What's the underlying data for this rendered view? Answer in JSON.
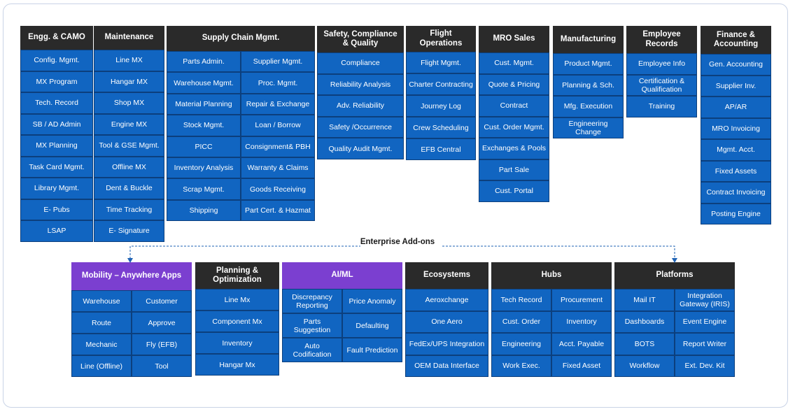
{
  "top_groups": [
    {
      "title": "Engg. & CAMO",
      "items": [
        "Config. Mgmt.",
        "MX Program",
        "Tech. Record",
        "SB / AD Admin",
        "MX Planning",
        "Task Card Mgmt.",
        "Library Mgmt.",
        "E- Pubs",
        "LSAP"
      ]
    },
    {
      "title": "Maintenance",
      "items": [
        "Line MX",
        "Hangar MX",
        "Shop MX",
        "Engine MX",
        "Tool & GSE Mgmt.",
        "Offline MX",
        "Dent & Buckle",
        "Time Tracking",
        "E- Signature"
      ]
    },
    {
      "title": "Supply Chain Mgmt.",
      "items": [
        "Parts Admin.",
        "Supplier Mgmt.",
        "Warehouse Mgmt.",
        "Proc. Mgmt.",
        "Material Planning",
        "Repair & Exchange",
        "Stock Mgmt.",
        "Loan / Borrow",
        "PICC",
        "Consignment& PBH",
        "Inventory Analysis",
        "Warranty & Claims",
        "Scrap Mgmt.",
        "Goods Receiving",
        "Shipping",
        "Part Cert. & Hazmat"
      ]
    },
    {
      "title": "Safety, Compliance & Quality",
      "items": [
        "Compliance",
        "Reliability Analysis",
        "Adv. Reliability",
        "Safety /Occurrence",
        "Quality Audit Mgmt."
      ]
    },
    {
      "title": "Flight Operations",
      "items": [
        "Flight Mgmt.",
        "Charter Contracting",
        "Journey Log",
        "Crew Scheduling",
        "EFB Central"
      ]
    },
    {
      "title": "MRO Sales",
      "items": [
        "Cust. Mgmt.",
        "Quote & Pricing",
        "Contract",
        "Cust. Order Mgmt.",
        "Exchanges & Pools",
        "Part Sale",
        "Cust. Portal"
      ]
    },
    {
      "title": "Manufacturing",
      "items": [
        "Product Mgmt.",
        "Planning & Sch.",
        "Mfg. Execution",
        "Engineering Change"
      ]
    },
    {
      "title": "Employee Records",
      "items": [
        "Employee Info",
        "Certification & Qualification",
        "Training"
      ]
    },
    {
      "title": "Finance & Accounting",
      "items": [
        "Gen. Accounting",
        "Supplier Inv.",
        "AP/AR",
        "MRO Invoicing",
        "Mgmt. Acct.",
        "Fixed Assets",
        "Contract Invoicing",
        "Posting Engine"
      ]
    }
  ],
  "enterprise_addons_label": "Enterprise Add-ons",
  "bottom_groups": [
    {
      "title": "Mobility – Anywhere Apps",
      "items": [
        "Warehouse",
        "Customer",
        "Route",
        "Approve",
        "Mechanic",
        "Fly (EFB)",
        "Line (Offline)",
        "Tool"
      ]
    },
    {
      "title": "Planning & Optimization",
      "items": [
        "Line Mx",
        "Component Mx",
        "Inventory",
        "Hangar Mx"
      ]
    },
    {
      "title": "AI/ML",
      "items": [
        "Discrepancy Reporting",
        "Price Anomaly",
        "Parts Suggestion",
        "Defaulting",
        "Auto Codification",
        "Fault Prediction"
      ]
    },
    {
      "title": "Ecosystems",
      "items": [
        "Aeroxchange",
        "One Aero",
        "FedEx/UPS Integration",
        "OEM Data Interface"
      ]
    },
    {
      "title": "Hubs",
      "items": [
        "Tech Record",
        "Procurement",
        "Cust. Order",
        "Inventory",
        "Engineering",
        "Acct. Payable",
        "Work Exec.",
        "Fixed Asset"
      ]
    },
    {
      "title": "Platforms",
      "items": [
        "Mail IT",
        "Integration Gateway (IRIS)",
        "Dashboards",
        "Event Engine",
        "BOTS",
        "Report Writer",
        "Workflow",
        "Ext. Dev. Kit"
      ]
    }
  ],
  "colors": {
    "header_dark": "#2a2a2a",
    "header_purple": "#7b3fd0",
    "cell_blue": "#1165c1",
    "connector": "#1f63b5"
  }
}
